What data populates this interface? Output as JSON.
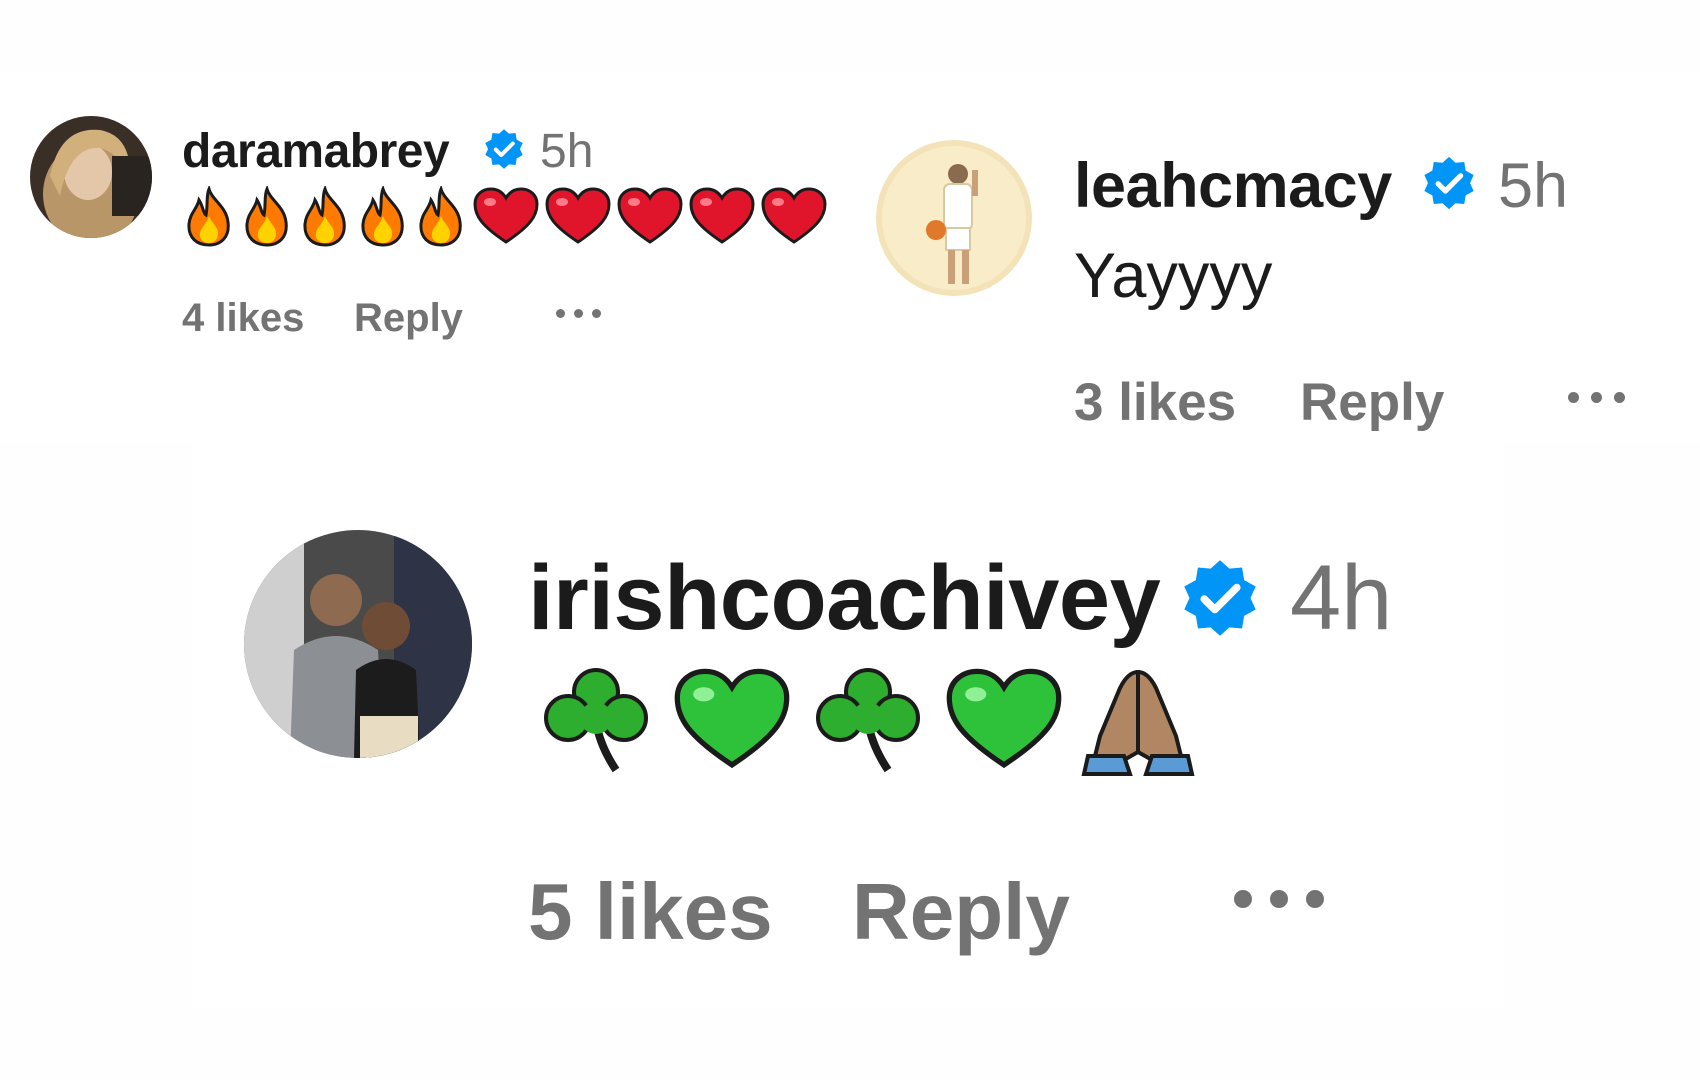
{
  "comments": [
    {
      "username": "daramabrey",
      "verified": true,
      "time": "5h",
      "emojis": [
        "fire-emoji",
        "fire-emoji",
        "fire-emoji",
        "fire-emoji",
        "fire-emoji",
        "red-heart-emoji",
        "red-heart-emoji",
        "red-heart-emoji",
        "red-heart-emoji",
        "red-heart-emoji"
      ],
      "likes": "4 likes",
      "reply": "Reply"
    },
    {
      "username": "leahcmacy",
      "verified": true,
      "time": "5h",
      "text": "Yayyyy",
      "likes": "3 likes",
      "reply": "Reply"
    },
    {
      "username": "irishcoachivey",
      "verified": true,
      "time": "4h",
      "emojis": [
        "shamrock-emoji",
        "green-heart-emoji",
        "shamrock-emoji",
        "green-heart-emoji",
        "folded-hands-emoji"
      ],
      "likes": "5 likes",
      "reply": "Reply"
    }
  ],
  "colors": {
    "verified_blue": "#0095f6",
    "meta_gray": "#737373",
    "text": "#1b1b1b",
    "heart_red": "#e0142b",
    "heart_green": "#2ec13a",
    "fire_orange": "#ff7a00"
  }
}
